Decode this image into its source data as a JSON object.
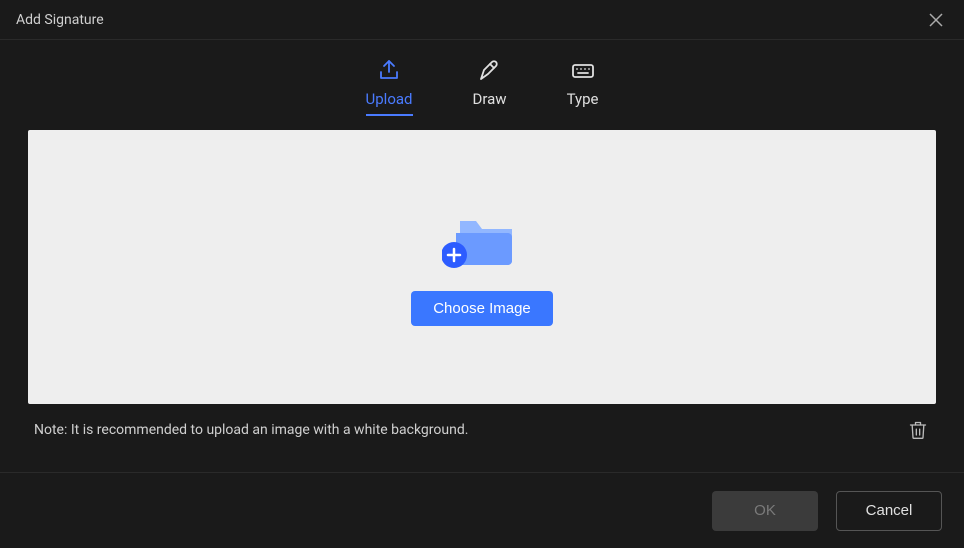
{
  "titlebar": {
    "title": "Add Signature"
  },
  "tabs": {
    "upload": {
      "label": "Upload"
    },
    "draw": {
      "label": "Draw"
    },
    "type": {
      "label": "Type"
    }
  },
  "content": {
    "choose_label": "Choose Image"
  },
  "note": {
    "text": "Note: It is recommended to upload an image with a white background."
  },
  "footer": {
    "ok_label": "OK",
    "cancel_label": "Cancel"
  }
}
